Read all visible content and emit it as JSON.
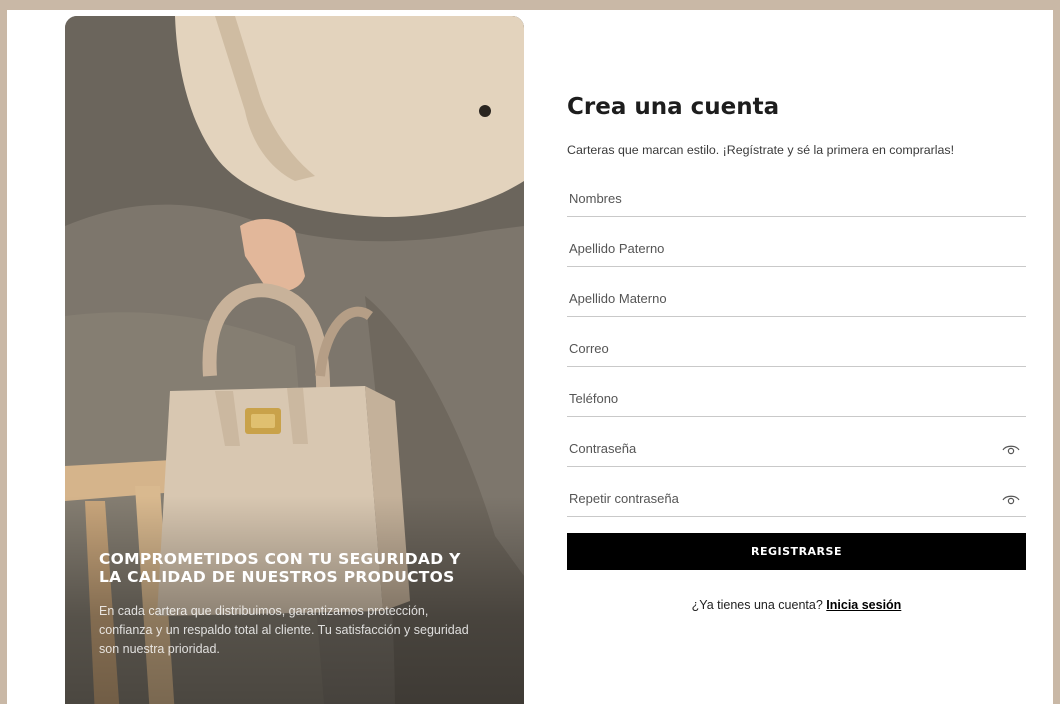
{
  "hero": {
    "heading": "COMPROMETIDOS CON TU SEGURIDAD Y LA CALIDAD DE NUESTROS PRODUCTOS",
    "text": "En cada cartera que distribuimos, garantizamos protección, confianza y un respaldo total al cliente. Tu satisfacción y seguridad son nuestra prioridad."
  },
  "form": {
    "title": "Crea una cuenta",
    "subtitle": "Carteras que marcan estilo. ¡Regístrate y sé la primera en comprarlas!",
    "fields": [
      {
        "placeholder": "Nombres",
        "value": ""
      },
      {
        "placeholder": "Apellido Paterno",
        "value": ""
      },
      {
        "placeholder": "Apellido Materno",
        "value": ""
      },
      {
        "placeholder": "Correo",
        "value": ""
      },
      {
        "placeholder": "Teléfono",
        "value": ""
      },
      {
        "placeholder": "Contraseña",
        "value": "",
        "icon": "eye-icon"
      },
      {
        "placeholder": "Repetir contraseña",
        "value": "",
        "icon": "eye-icon"
      }
    ],
    "submit_label": "REGISTRARSE",
    "login_prompt": "¿Ya tienes una cuenta?",
    "login_link": "Inicia sesión"
  },
  "colors": {
    "page_background": "#c9b8a6",
    "button": "#000000",
    "field_border": "#c9c9c9"
  }
}
